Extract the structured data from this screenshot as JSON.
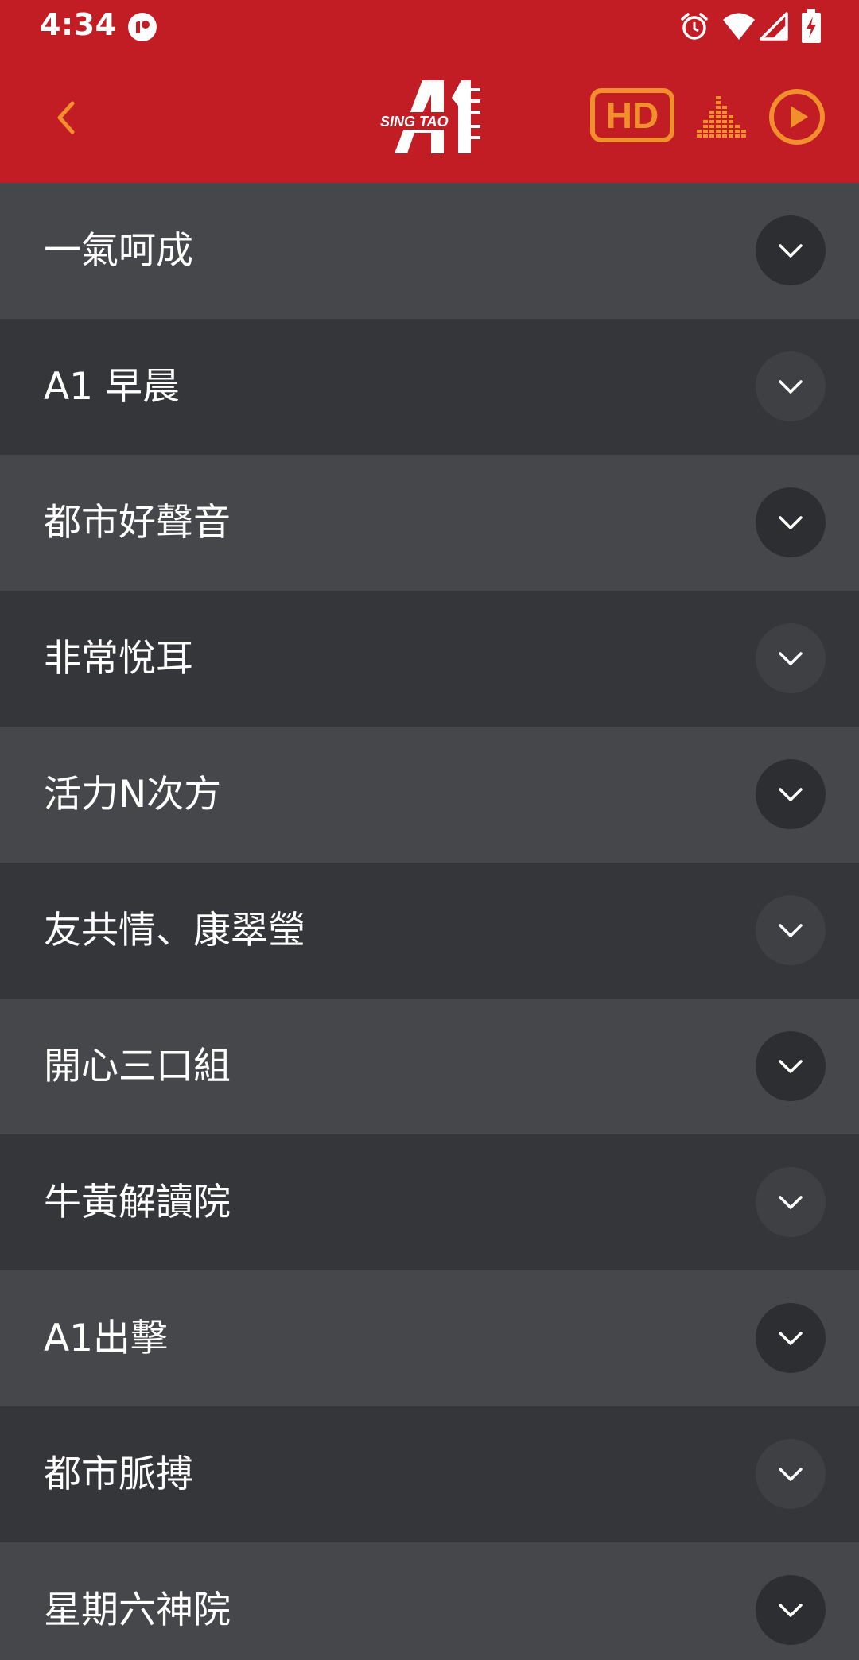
{
  "status_bar": {
    "time": "4:34",
    "icons": [
      "app-notification-icon",
      "alarm-icon",
      "wifi-icon",
      "signal-icon",
      "battery-charging-icon"
    ]
  },
  "toolbar": {
    "back_icon": "chevron-left-icon",
    "logo_icon": "singtao-a1-logo",
    "logo_text": "SING TAO",
    "hd_label": "HD",
    "equalizer_icon": "equalizer-icon",
    "play_icon": "play-circle-icon"
  },
  "colors": {
    "header_red": "#c21d24",
    "accent_orange": "#f08f2c",
    "row_light": "#46474a",
    "row_dark": "#35363a",
    "text_white": "#ffffff"
  },
  "programs": [
    {
      "title": "一氣呵成"
    },
    {
      "title": "A1 早晨"
    },
    {
      "title": "都市好聲音"
    },
    {
      "title": "非常悅耳"
    },
    {
      "title": "活力N次方"
    },
    {
      "title": "友共情、康翠瑩"
    },
    {
      "title": "開心三口組"
    },
    {
      "title": "牛黃解讀院"
    },
    {
      "title": "A1出擊"
    },
    {
      "title": "都市脈搏"
    },
    {
      "title": "星期六神院"
    }
  ]
}
